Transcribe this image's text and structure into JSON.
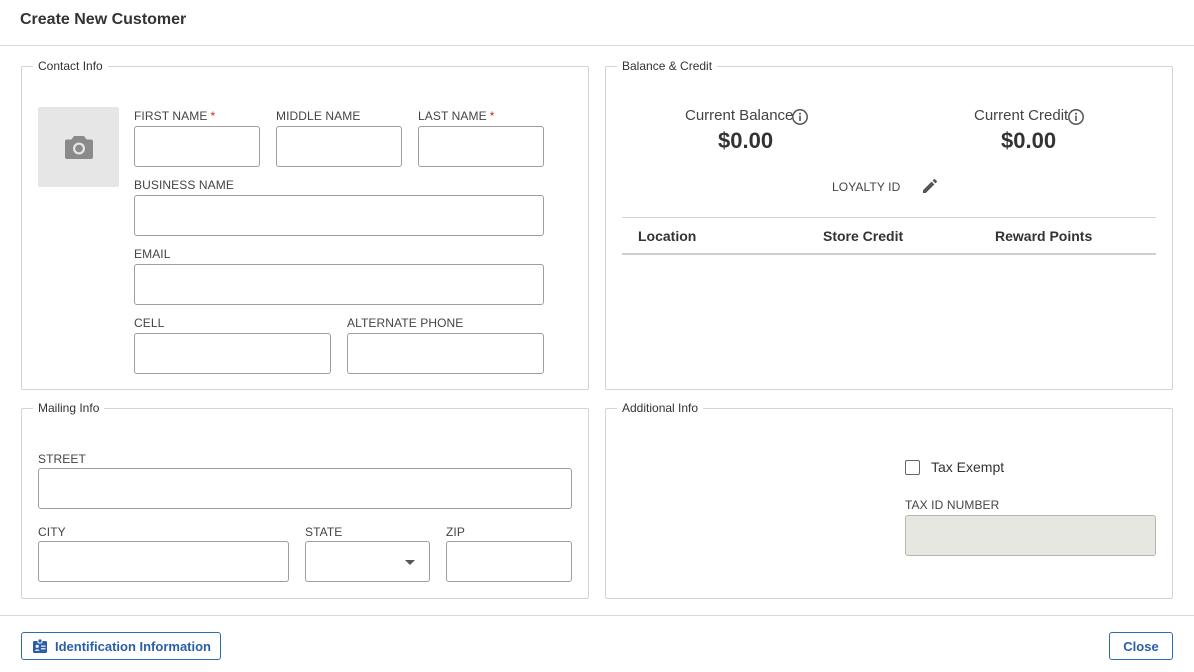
{
  "dialog": {
    "title": "Create New Customer"
  },
  "contact": {
    "legend": "Contact Info",
    "photo_icon": "camera-icon",
    "first_name_label": "FIRST NAME",
    "middle_name_label": "MIDDLE NAME",
    "last_name_label": "LAST NAME",
    "required_mark": "*",
    "business_name_label": "BUSINESS NAME",
    "email_label": "EMAIL",
    "cell_label": "CELL",
    "alt_phone_label": "ALTERNATE PHONE",
    "first_name": "",
    "middle_name": "",
    "last_name": "",
    "business_name": "",
    "email": "",
    "cell": "",
    "alt_phone": ""
  },
  "balance": {
    "legend": "Balance & Credit",
    "current_balance_label": "Current Balance",
    "current_balance_value": "$0.00",
    "current_credit_label": "Current Credit",
    "current_credit_value": "$0.00",
    "loyalty_label": "LOYALTY ID",
    "edit_icon": "pencil-icon",
    "table_headers": [
      "Location",
      "Store Credit",
      "Reward Points"
    ],
    "table_rows": []
  },
  "mailing": {
    "legend": "Mailing Info",
    "street_label": "STREET",
    "city_label": "CITY",
    "state_label": "STATE",
    "zip_label": "ZIP",
    "street": "",
    "city": "",
    "state": "",
    "zip": ""
  },
  "additional": {
    "legend": "Additional Info",
    "tax_exempt_label": "Tax Exempt",
    "tax_exempt_checked": false,
    "tax_id_label": "TAX ID NUMBER",
    "tax_id": ""
  },
  "footer": {
    "id_button_label": "Identification Information",
    "id_button_icon": "id-badge-icon",
    "close_label": "Close"
  },
  "colors": {
    "accent": "#2a5fa8",
    "required": "#c62828",
    "border": "#d3d3d3"
  }
}
